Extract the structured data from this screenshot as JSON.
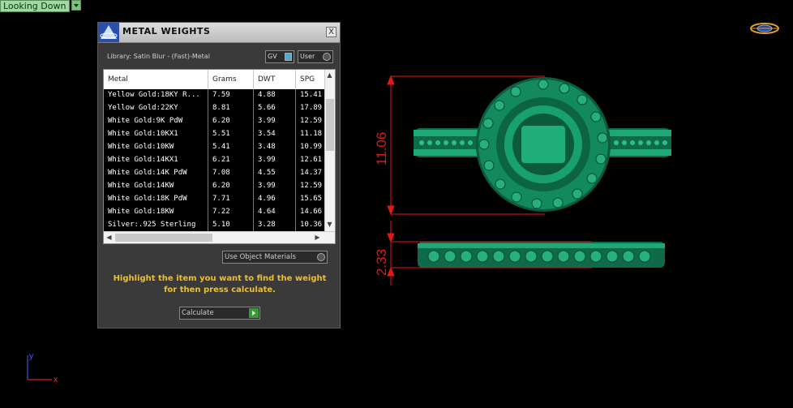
{
  "viewport": {
    "label": "Looking Down"
  },
  "dialog": {
    "title": "METAL WEIGHTS",
    "close_label": "X",
    "library": "Library: Satin Blur - (Fast)-Metal",
    "gv_label": "GV",
    "user_label": "User",
    "use_object_label": "Use Object Materials",
    "instructions_line1": "Highlight the item you want to find the weight",
    "instructions_line2": "for then press calculate.",
    "calculate_label": "Calculate"
  },
  "table": {
    "columns": [
      "Metal",
      "Grams",
      "DWT",
      "SPG"
    ],
    "rows": [
      [
        "Yellow Gold:18KY R...",
        "7.59",
        "4.88",
        "15.41"
      ],
      [
        "Yellow Gold:22KY",
        "8.81",
        "5.66",
        "17.89"
      ],
      [
        "White Gold:9K PdW",
        "6.20",
        "3.99",
        "12.59"
      ],
      [
        "White Gold:10KX1",
        "5.51",
        "3.54",
        "11.18"
      ],
      [
        "White Gold:10KW",
        "5.41",
        "3.48",
        "10.99"
      ],
      [
        "White Gold:14KX1",
        "6.21",
        "3.99",
        "12.61"
      ],
      [
        "White Gold:14K PdW",
        "7.08",
        "4.55",
        "14.37"
      ],
      [
        "White Gold:14KW",
        "6.20",
        "3.99",
        "12.59"
      ],
      [
        "White Gold:18K PdW",
        "7.71",
        "4.96",
        "15.65"
      ],
      [
        "White Gold:18KW",
        "7.22",
        "4.64",
        "14.66"
      ],
      [
        "Silver:.925 Sterling",
        "5.10",
        "3.28",
        "10.36"
      ]
    ]
  },
  "dimensions": {
    "height": "11.06",
    "band": "2.33"
  },
  "axes": {
    "y": "y",
    "x": "x"
  },
  "colors": {
    "ring": "#138a5e",
    "dimension": "#e01818",
    "instructions": "#f0c020"
  }
}
